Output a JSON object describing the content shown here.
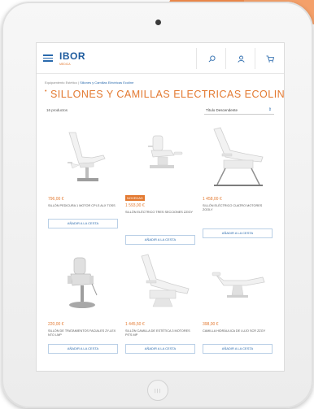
{
  "brand": {
    "name": "IBOR",
    "tagline": "MEDICA"
  },
  "header": {
    "search_icon": "search-icon",
    "user_icon": "user-icon",
    "cart_icon": "cart-icon"
  },
  "breadcrumb": {
    "root": "Equipamiento Estético",
    "sep": " | ",
    "current": "Sillones y Camillas Eléctricas Ecoline"
  },
  "page": {
    "title": "SILLONES Y CAMILLAS ELECTRICAS ECOLINE",
    "title_mark": "•",
    "count": "16 productos",
    "sort_value": "Título Descendente"
  },
  "products": [
    {
      "price": "796,00 €",
      "name": "SILLÓN PEDICURA 1 MOTOR CPI-S ALX TOSS",
      "button": "AÑADIR A LA CESTA",
      "badge": ""
    },
    {
      "price": "1 593,00 €",
      "name": "SILLÓN ELÉCTRICO TRES SECCIONES ZZIGY",
      "button": "AÑADIR A LA CESTA",
      "badge": "NOVEDAD"
    },
    {
      "price": "1 458,00 €",
      "name": "SILLÓN ELÉCTRICO CUATRO MOTORES ZOOLY",
      "button": "AÑADIR A LA CESTA",
      "badge": ""
    },
    {
      "price": "220,00 €",
      "name": "SILLÓN DE TRATAMIENTOS FACIALES ZY-LEX NTO LMP",
      "button": "AÑADIR A LA CESTA",
      "badge": ""
    },
    {
      "price": "1 445,50 €",
      "name": "SILLÓN CAMILLA DE ESTÉTICA 3 MOTORES PITS MP",
      "button": "AÑADIR A LA CESTA",
      "badge": ""
    },
    {
      "price": "398,00 €",
      "name": "CAMILLA HIDRÁULICA DE LUJO SCR ZZGY",
      "button": "AÑADIR A LA CESTA",
      "badge": ""
    }
  ],
  "colors": {
    "accent": "#e37930",
    "brand": "#1f5c9e",
    "button_border": "#b9cfe6"
  }
}
